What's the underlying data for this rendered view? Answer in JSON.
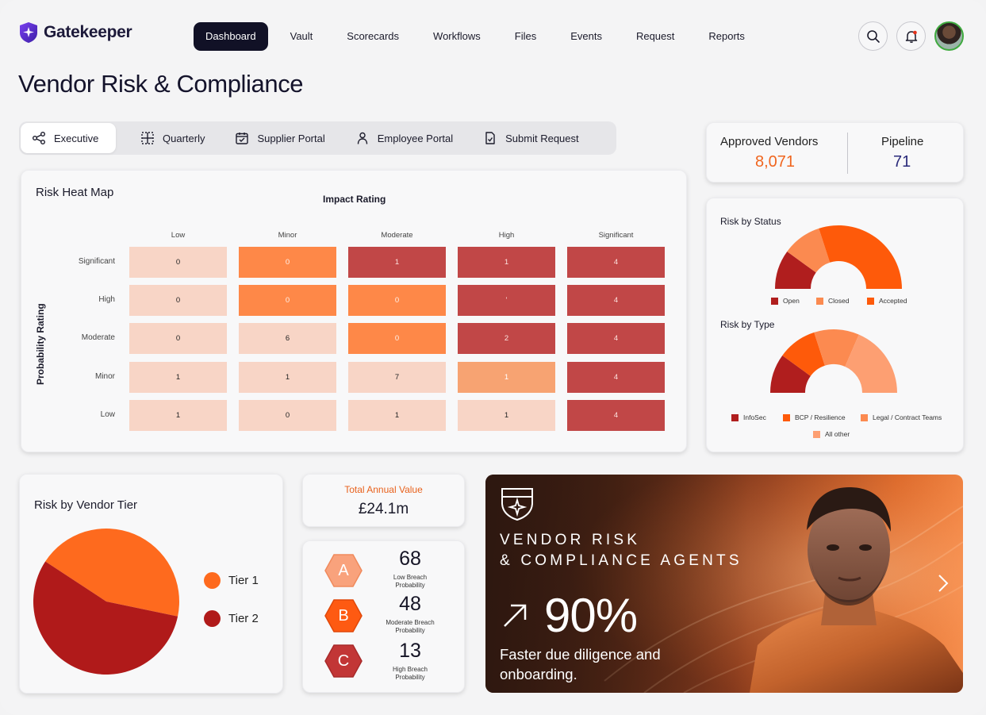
{
  "app": {
    "name": "Gatekeeper"
  },
  "nav": {
    "items": [
      "Dashboard",
      "Vault",
      "Scorecards",
      "Workflows",
      "Files",
      "Events",
      "Request",
      "Reports"
    ],
    "active": "Dashboard"
  },
  "header": {
    "search_icon": "search-icon",
    "notification_icon": "bell-icon"
  },
  "page": {
    "title": "Vendor Risk & Compliance"
  },
  "tabs": [
    {
      "label": "Executive",
      "icon": "share-nodes-icon",
      "active": true
    },
    {
      "label": "Quarterly",
      "icon": "grid-dashed-icon"
    },
    {
      "label": "Supplier Portal",
      "icon": "calendar-check-icon"
    },
    {
      "label": "Employee Portal",
      "icon": "person-icon"
    },
    {
      "label": "Submit Request",
      "icon": "document-check-icon"
    }
  ],
  "stats": {
    "approved_label": "Approved Vendors",
    "approved_value": "8,071",
    "pipeline_label": "Pipeline",
    "pipeline_value": "71"
  },
  "heatmap": {
    "title": "Risk Heat Map",
    "x_title": "Impact Rating",
    "y_title": "Probability Rating",
    "columns": [
      "Low",
      "Minor",
      "Moderate",
      "High",
      "Significant"
    ],
    "rows": [
      "Significant",
      "High",
      "Moderate",
      "Minor",
      "Low"
    ],
    "values": [
      [
        "0",
        "0",
        "1",
        "1",
        "4"
      ],
      [
        "0",
        "0",
        "0",
        "'",
        "4"
      ],
      [
        "0",
        "6",
        "0",
        "2",
        "4"
      ],
      [
        "1",
        "1",
        "7",
        "1",
        "4"
      ],
      [
        "1",
        "0",
        "1",
        "1",
        "4"
      ]
    ],
    "levels": [
      [
        1,
        2,
        3,
        3,
        3
      ],
      [
        1,
        2,
        2,
        3,
        3
      ],
      [
        1,
        1,
        2,
        3,
        3
      ],
      [
        1,
        1,
        1,
        2,
        3
      ],
      [
        1,
        1,
        1,
        1,
        3
      ]
    ],
    "colors": {
      "1": "#f8d5c6",
      "2": "#fe8848",
      "3": "#c14747"
    }
  },
  "risk_status": {
    "title": "Risk by Status",
    "legend": [
      {
        "label": "Open",
        "color": "#b01e1e"
      },
      {
        "label": "Closed",
        "color": "#fb8a50"
      },
      {
        "label": "Accepted",
        "color": "#fe5a0a"
      }
    ]
  },
  "risk_type": {
    "title": "Risk by Type",
    "legend": [
      {
        "label": "InfoSec",
        "color": "#b01e1e"
      },
      {
        "label": "BCP / Resilience",
        "color": "#fe5a0a"
      },
      {
        "label": "Legal / Contract Teams",
        "color": "#fc8a50"
      },
      {
        "label": "All other",
        "color": "#fd9f72"
      }
    ]
  },
  "chart_data": [
    {
      "type": "pie",
      "title": "Risk by Status",
      "categories": [
        "Open",
        "Closed",
        "Accepted"
      ],
      "values": [
        20,
        20,
        60
      ],
      "colors": [
        "#b01e1e",
        "#fb8a50",
        "#fe5a0a"
      ],
      "shape": "half-donut"
    },
    {
      "type": "pie",
      "title": "Risk by Type",
      "categories": [
        "InfoSec",
        "BCP / Resilience",
        "Legal / Contract Teams",
        "All other"
      ],
      "values": [
        20,
        20,
        23,
        37
      ],
      "colors": [
        "#b01e1e",
        "#fe5a0a",
        "#fc8a50",
        "#fd9f72"
      ],
      "shape": "half-donut"
    },
    {
      "type": "pie",
      "title": "Risk by Vendor Tier",
      "categories": [
        "Tier 1",
        "Tier 2"
      ],
      "values": [
        44,
        56
      ],
      "colors": [
        "#fe6a1e",
        "#b01a1a"
      ]
    }
  ],
  "tier": {
    "title": "Risk by Vendor Tier",
    "legend": [
      {
        "label": "Tier 1",
        "color": "#fe6a1e"
      },
      {
        "label": "Tier 2",
        "color": "#b01a1a"
      }
    ]
  },
  "total_annual_value": {
    "label": "Total Annual Value",
    "value": "£24.1m"
  },
  "breach": [
    {
      "grade": "A",
      "value": "68",
      "label": "Low Breach Probability",
      "color": "#f9a27c"
    },
    {
      "grade": "B",
      "value": "48",
      "label": "Moderate Breach Probability",
      "color": "#fe5a12"
    },
    {
      "grade": "C",
      "value": "13",
      "label": "High Breach Probability",
      "color": "#c23636"
    }
  ],
  "promo": {
    "title_line1": "VENDOR RISK",
    "title_line2": "& COMPLIANCE AGENTS",
    "stat": "90%",
    "subtitle": "Faster due diligence and onboarding.",
    "icon": "shield-star-icon",
    "arrow_icon": "arrow-up-right-icon",
    "next_icon": "chevron-right-icon"
  }
}
